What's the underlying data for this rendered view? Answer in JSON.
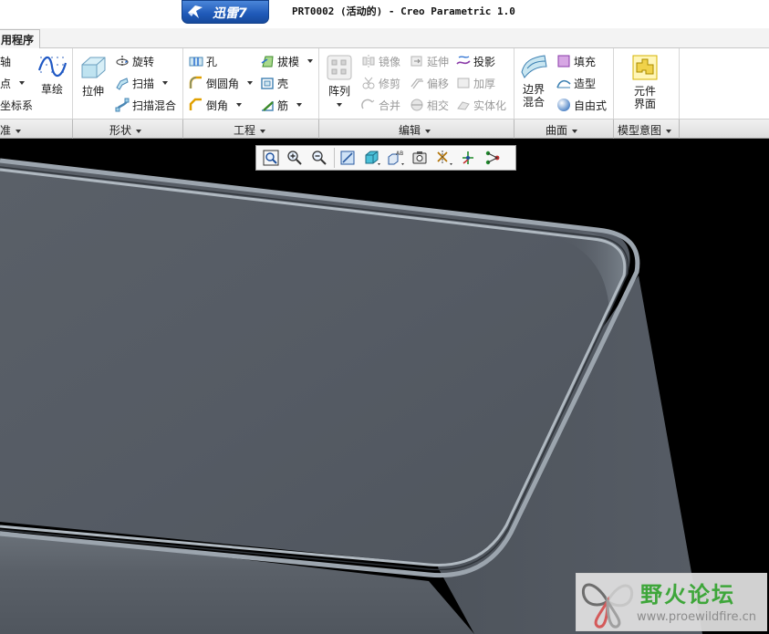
{
  "titlebar": {
    "badge_text": "迅雷7",
    "window_title": "PRT0002 (活动的) - Creo Parametric 1.0"
  },
  "tabs": {
    "apps_label": "用程序"
  },
  "ribbon": {
    "datum": {
      "items": [
        "轴",
        "点",
        "坐标系"
      ],
      "sketch_label": "草绘",
      "group_label": "准"
    },
    "shapes": {
      "extrude_label": "拉伸",
      "revolve_label": "旋转",
      "sweep_label": "扫描",
      "swept_blend_label": "扫描混合",
      "group_label": "形状"
    },
    "engineering": {
      "hole_label": "孔",
      "round_label": "倒圆角",
      "chamfer_label": "倒角",
      "draft_label": "拔模",
      "shell_label": "壳",
      "rib_label": "筋",
      "group_label": "工程"
    },
    "editing": {
      "pattern_label": "阵列",
      "mirror_label": "镜像",
      "trim_label": "修剪",
      "merge_label": "合并",
      "extend_label": "延伸",
      "offset_label": "偏移",
      "intersect_label": "相交",
      "project_label": "投影",
      "thicken_label": "加厚",
      "solidify_label": "实体化",
      "group_label": "编辑"
    },
    "surfaces": {
      "boundary_label": "边界混合",
      "fill_label": "填充",
      "style_label": "造型",
      "freestyle_label": "自由式",
      "group_label": "曲面"
    },
    "model_intent": {
      "component_label": "元件界面",
      "group_label": "模型意图"
    }
  },
  "view_toolbar": {
    "icons": [
      "refit-icon",
      "zoom-in-icon",
      "zoom-out-icon",
      "repaint-icon",
      "display-style-icon",
      "saved-views-icon",
      "view-manager-icon",
      "datum-display-icon",
      "spin-center-icon",
      "annotation-display-icon"
    ]
  },
  "watermark": {
    "title": "野火论坛",
    "url": "www.proewildfire.cn"
  },
  "colors": {
    "viewport_background": "#000000",
    "model_surface": "#555b64",
    "model_edge": "#aab3bc",
    "watermark_green": "#3ea63a"
  }
}
